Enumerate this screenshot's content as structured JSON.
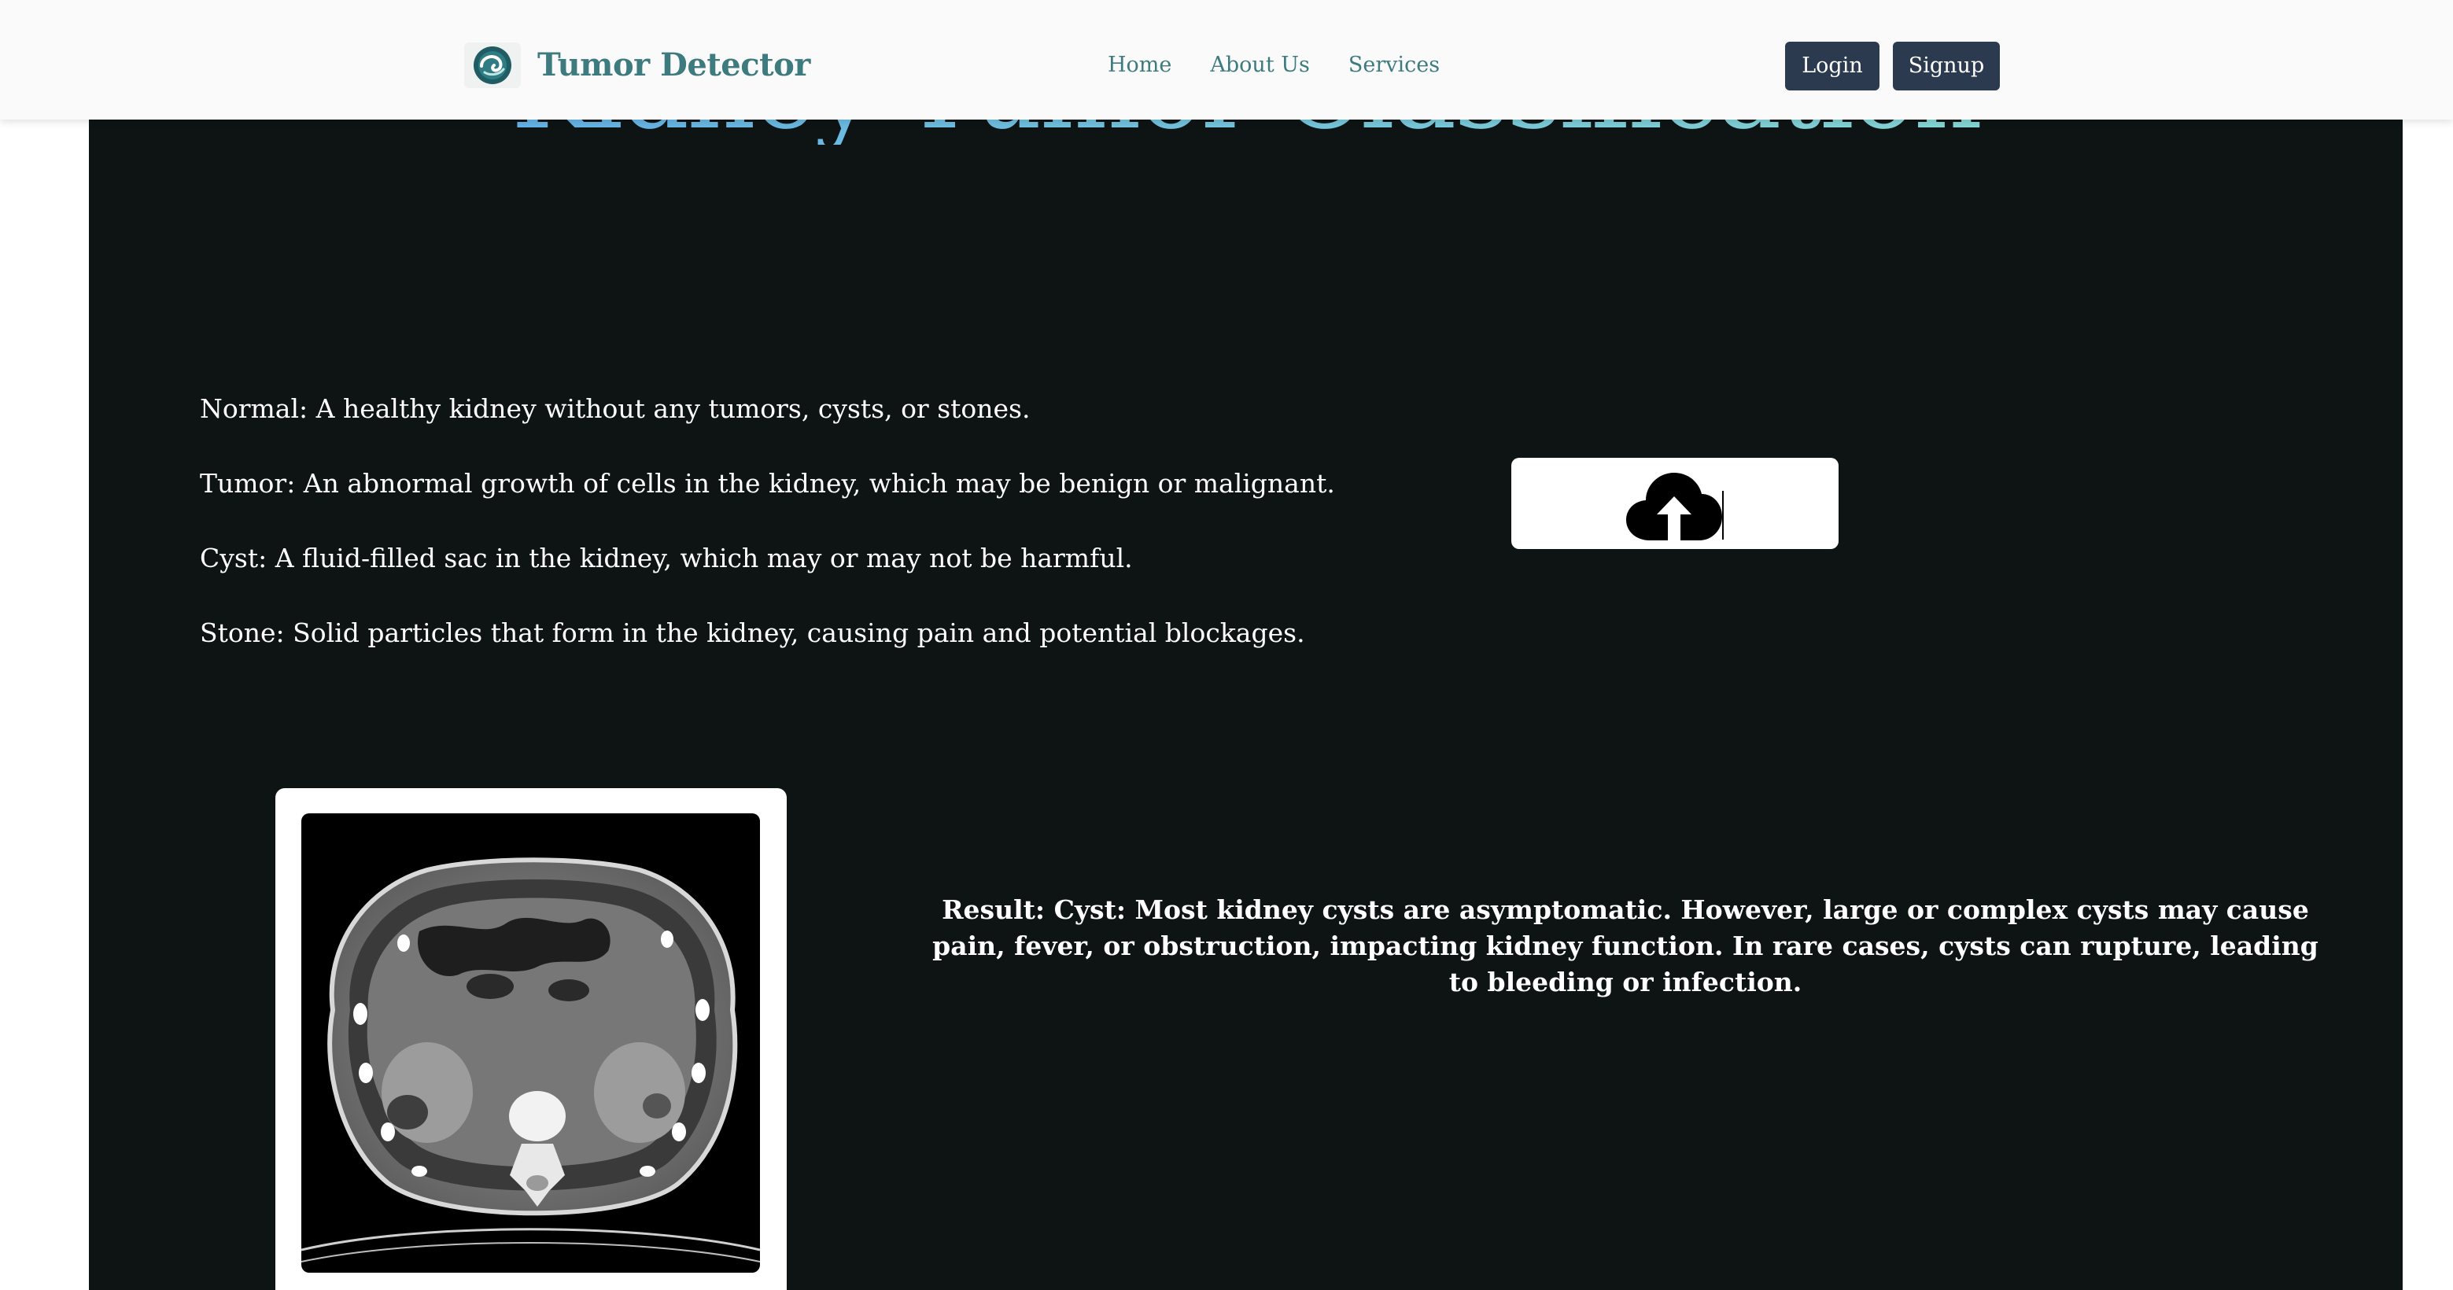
{
  "navbar": {
    "brand": "Tumor Detector",
    "logo_icon": "kidney-logo-icon",
    "links": [
      "Home",
      "About Us",
      "Services"
    ],
    "login_label": "Login",
    "signup_label": "Signup"
  },
  "page": {
    "title": "Kidney Tumor Classification"
  },
  "definitions": [
    "Normal: A healthy kidney without any tumors, cysts, or stones.",
    "Tumor: An abnormal growth of cells in the kidney, which may be benign or malignant.",
    "Cyst: A fluid-filled sac in the kidney, which may or may not be harmful.",
    "Stone: Solid particles that form in the kidney, causing pain and potential blockages."
  ],
  "upload": {
    "icon": "cloud-upload-icon"
  },
  "scan": {
    "image": "ct-scan-image"
  },
  "result": {
    "text": "Result: Cyst: Most kidney cysts are asymptomatic. However, large or complex cysts may cause pain, fever, or obstruction, impacting kidney function. In rare cases, cysts can rupture, leading to bleeding or infection."
  },
  "colors": {
    "background_dark": "#0e1414",
    "brand_teal": "#3e7b7e",
    "button_navy": "#2b3a4e",
    "title_gradient_start": "#5ba7ec",
    "title_gradient_end": "#8fe0d2"
  }
}
